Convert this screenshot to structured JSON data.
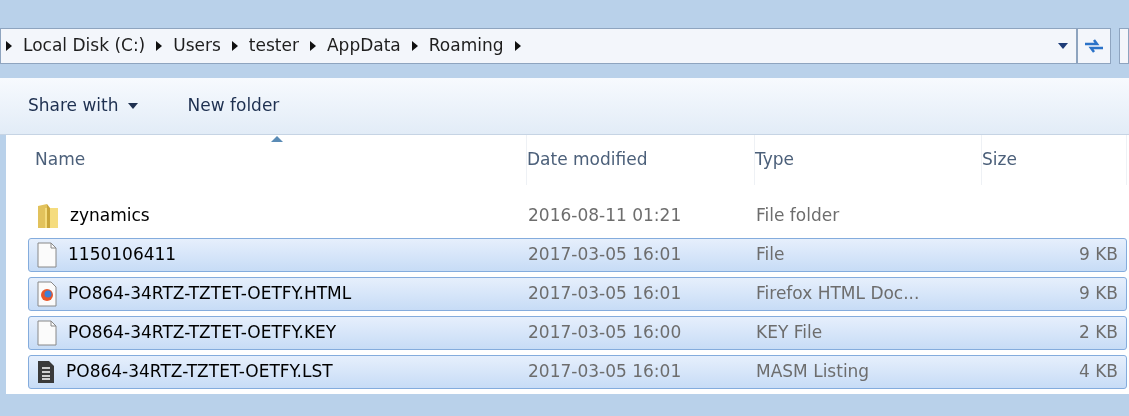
{
  "address_bar": {
    "breadcrumbs": [
      "Local Disk (C:)",
      "Users",
      "tester",
      "AppData",
      "Roaming"
    ]
  },
  "toolbar": {
    "buttons": [
      {
        "label": "Share with",
        "kind": "menu"
      },
      {
        "label": "New folder",
        "kind": "plain"
      }
    ]
  },
  "table": {
    "columns": [
      {
        "label": "Name",
        "sorted": true
      },
      {
        "label": "Date modified",
        "sorted": false
      },
      {
        "label": "Type",
        "sorted": false
      },
      {
        "label": "Size",
        "sorted": false
      }
    ],
    "rows": [
      {
        "name": "zynamics",
        "kind": "folder",
        "date": "2016-08-11 01:21",
        "type": "File folder",
        "size": "",
        "selected": false
      },
      {
        "name": "1150106411",
        "kind": "blank",
        "date": "2017-03-05 16:01",
        "type": "File",
        "size": "9 KB",
        "selected": true
      },
      {
        "name": "PO864-34RTZ-TZTET-OETFY.HTML",
        "kind": "firefox",
        "date": "2017-03-05 16:01",
        "type": "Firefox HTML Doc...",
        "size": "9 KB",
        "selected": true
      },
      {
        "name": "PO864-34RTZ-TZTET-OETFY.KEY",
        "kind": "blank",
        "date": "2017-03-05 16:00",
        "type": "KEY File",
        "size": "2 KB",
        "selected": true
      },
      {
        "name": "PO864-34RTZ-TZTET-OETFY.LST",
        "kind": "text",
        "date": "2017-03-05 16:01",
        "type": "MASM Listing",
        "size": "4 KB",
        "selected": true
      }
    ]
  }
}
